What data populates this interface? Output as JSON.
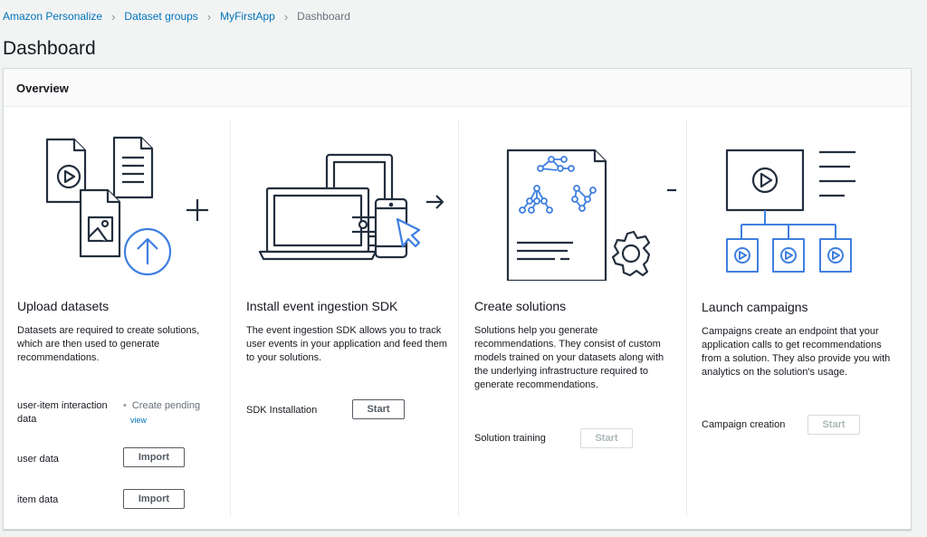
{
  "breadcrumb": {
    "items": [
      "Amazon Personalize",
      "Dataset groups",
      "MyFirstApp"
    ],
    "current": "Dashboard"
  },
  "page": {
    "title": "Dashboard"
  },
  "overview": {
    "title": "Overview",
    "upload": {
      "title": "Upload datasets",
      "description": "Datasets are required to create solutions, which are then used to generate recommendations.",
      "rows": [
        {
          "label": "user-item interaction data",
          "status": "Create pending",
          "link": "view"
        },
        {
          "label": "user data",
          "button": "Import"
        },
        {
          "label": "item data",
          "button": "Import"
        }
      ]
    },
    "sdk": {
      "title": "Install event ingestion SDK",
      "description": "The event ingestion SDK allows you to track user events in your application and feed them to your solutions.",
      "row_label": "SDK Installation",
      "button": "Start"
    },
    "solutions": {
      "title": "Create solutions",
      "description": "Solutions help you generate recommendations. They consist of custom models trained on your datasets along with the underlying infrastructure required to generate recommendations.",
      "row_label": "Solution training",
      "button": "Start"
    },
    "campaigns": {
      "title": "Launch campaigns",
      "description": "Campaigns create an endpoint that your application calls to get recommendations from a solution. They also provide you with analytics on the solution's usage.",
      "row_label": "Campaign creation",
      "button": "Start"
    }
  },
  "colors": {
    "accent": "#0073bb",
    "ink": "#232f3e",
    "highlight": "#3f7fe0"
  }
}
